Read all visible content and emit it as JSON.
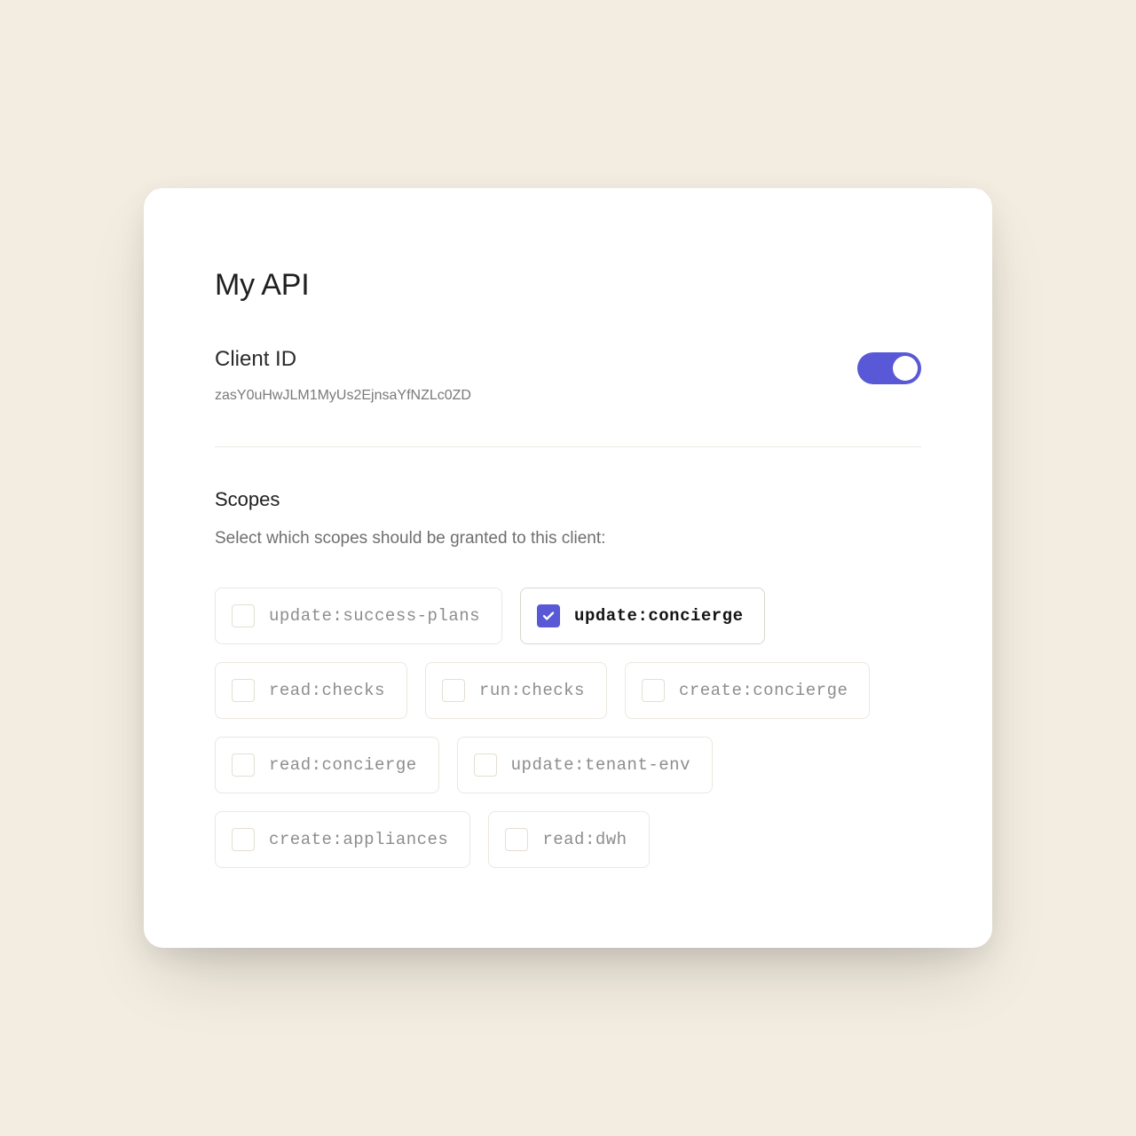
{
  "card": {
    "title": "My API",
    "client_id_label": "Client ID",
    "client_id_value": "zasY0uHwJLM1MyUs2EjnsaYfNZLc0ZD",
    "toggle_on": true
  },
  "scopes": {
    "heading": "Scopes",
    "help": "Select which scopes should be granted to this client:",
    "items": [
      {
        "label": "update:success-plans",
        "selected": false
      },
      {
        "label": "update:concierge",
        "selected": true
      },
      {
        "label": "read:checks",
        "selected": false
      },
      {
        "label": "run:checks",
        "selected": false
      },
      {
        "label": "create:concierge",
        "selected": false
      },
      {
        "label": "read:concierge",
        "selected": false
      },
      {
        "label": "update:tenant-env",
        "selected": false
      },
      {
        "label": "create:appliances",
        "selected": false
      },
      {
        "label": "read:dwh",
        "selected": false
      }
    ]
  },
  "colors": {
    "accent": "#5958d6",
    "card_bg": "#ffffff",
    "page_bg": "#f3ede1"
  }
}
